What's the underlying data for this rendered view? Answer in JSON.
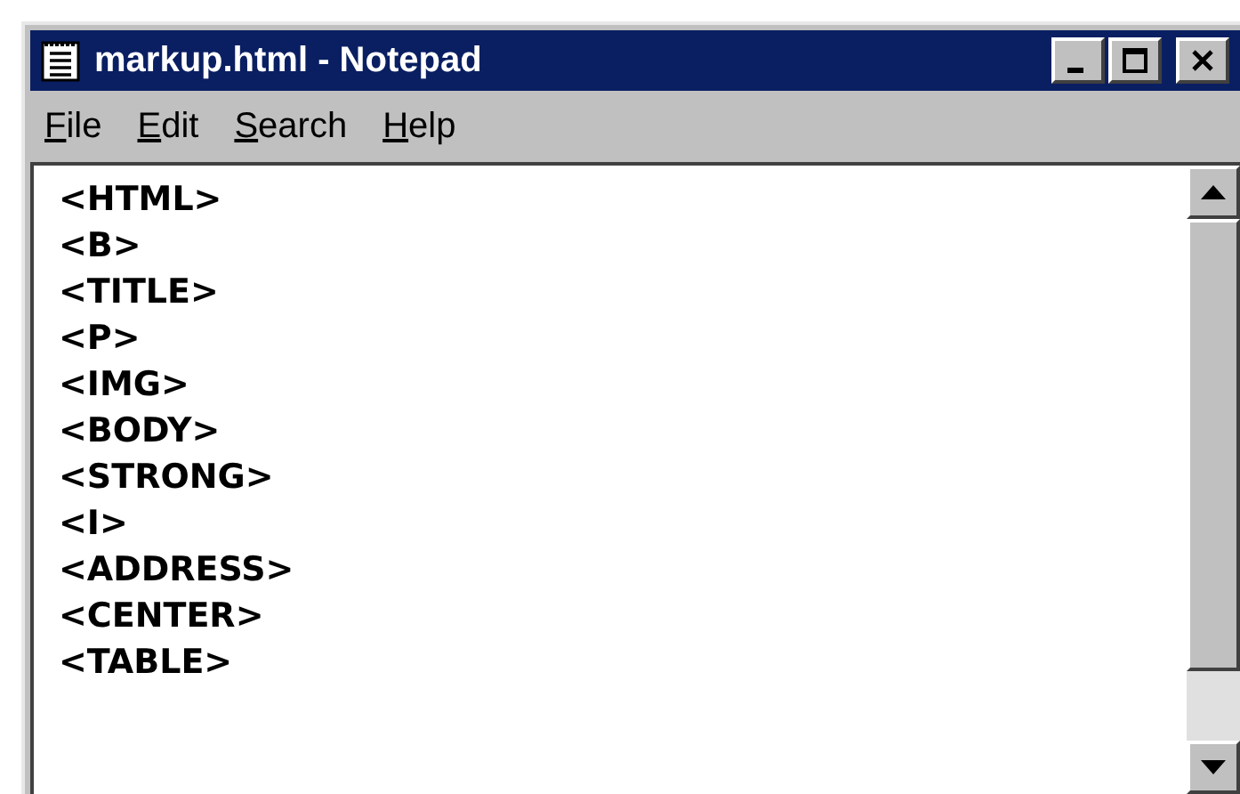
{
  "window": {
    "title": "markup.html - Notepad"
  },
  "menu": [
    {
      "label": "File"
    },
    {
      "label": "Edit"
    },
    {
      "label": "Search"
    },
    {
      "label": "Help"
    }
  ],
  "editor": {
    "lines": [
      "<HTML>",
      "<B>",
      "<TITLE>",
      "<P>",
      "<IMG>",
      "<BODY>",
      "<STRONG>",
      "<I>",
      "<ADDRESS>",
      "<CENTER>",
      "<TABLE>"
    ]
  }
}
